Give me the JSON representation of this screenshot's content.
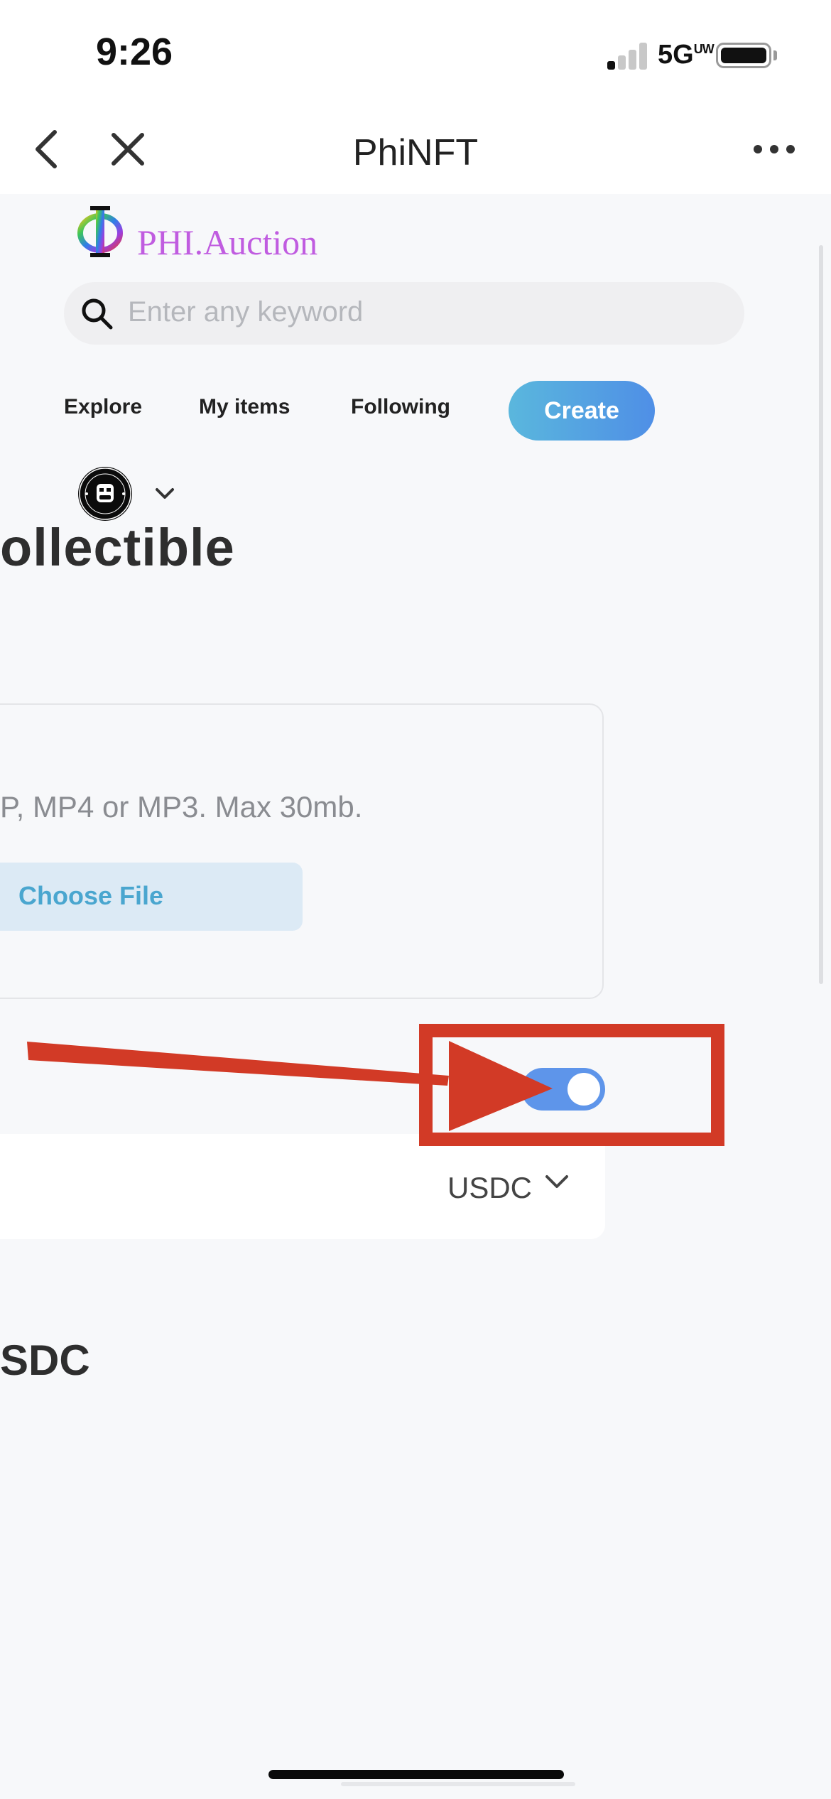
{
  "status_bar": {
    "time": "9:26",
    "network": "5G",
    "network_superscript": "UW",
    "signal_bars_active": 1,
    "signal_bars_total": 4
  },
  "nav": {
    "title": "PhiNFT",
    "back_icon": "chevron-left-icon",
    "close_icon": "close-icon",
    "more_icon": "ellipsis-icon"
  },
  "header": {
    "brand": "PHI.Auction",
    "logo_icon": "phi-logo-icon",
    "search_placeholder": "Enter any keyword"
  },
  "tabs": [
    {
      "label": "Explore"
    },
    {
      "label": "My items"
    },
    {
      "label": "Following"
    }
  ],
  "create_label": "Create",
  "profile": {
    "avatar_icon": "bored-ape-avatar",
    "dropdown_icon": "chevron-down-icon"
  },
  "form": {
    "heading": "ollectible",
    "upload_hint": "P, MP4 or MP3. Max 30mb.",
    "choose_file_label": "Choose File",
    "toggle_on": true,
    "currency": "USDC",
    "total_suffix": "SDC"
  },
  "colors": {
    "brand": "#c05ce0",
    "create_gradient_start": "#5ab7dd",
    "create_gradient_end": "#4f8fe6",
    "toggle_on": "#5e95ea",
    "annotation": "#d23a26"
  }
}
